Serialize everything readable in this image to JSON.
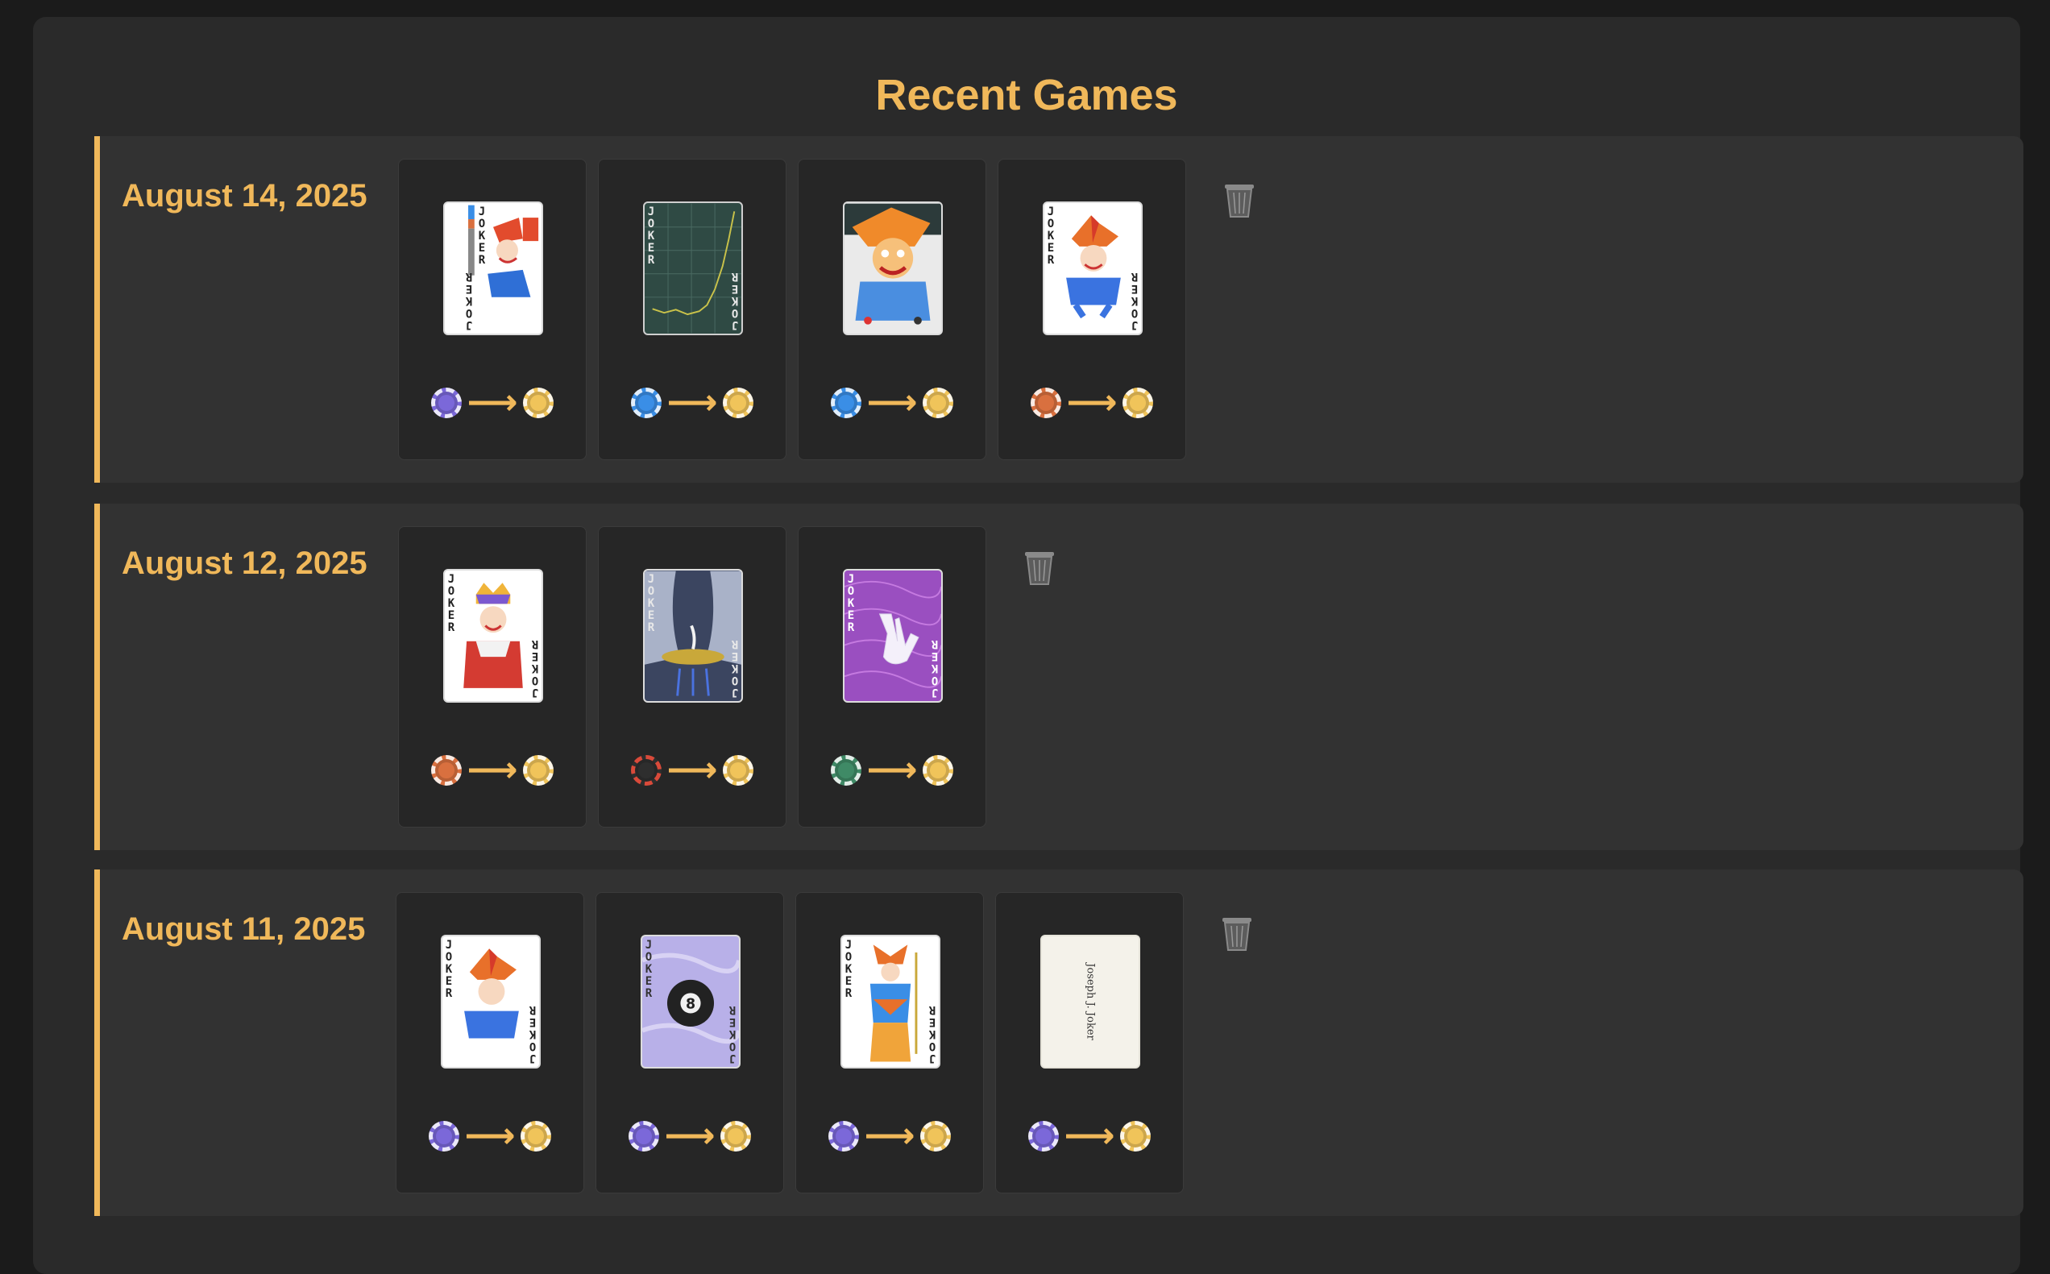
{
  "header": {
    "title": "Recent Games"
  },
  "colors": {
    "accent": "#f0b85a",
    "purple": "#7b68d9",
    "blue": "#3a8ee6",
    "orange": "#d9703f",
    "gold": "#f0c45a",
    "black": "#2e2e2e",
    "green": "#3f8a66"
  },
  "groups": [
    {
      "date": "August 14, 2025",
      "cards": [
        {
          "label": "JOKER",
          "theme": "color-bars-jester",
          "from_chip": "purple",
          "to_chip": "gold"
        },
        {
          "label": "JOKER",
          "theme": "green-graph",
          "from_chip": "blue",
          "to_chip": "gold"
        },
        {
          "label": "JOKER",
          "theme": "crazy-jester",
          "from_chip": "blue",
          "to_chip": "gold"
        },
        {
          "label": "JOKER",
          "theme": "classic-jester",
          "from_chip": "orange",
          "to_chip": "gold"
        }
      ],
      "delete_icon": "trash-icon"
    },
    {
      "date": "August 12, 2025",
      "cards": [
        {
          "label": "JOKER",
          "theme": "king-jester",
          "from_chip": "orange",
          "to_chip": "gold"
        },
        {
          "label": "JOKER",
          "theme": "stage-curtain",
          "from_chip": "black",
          "to_chip": "gold"
        },
        {
          "label": "JOKER",
          "theme": "purple-hand",
          "from_chip": "green",
          "to_chip": "gold"
        }
      ],
      "delete_icon": "trash-icon"
    },
    {
      "date": "August 11, 2025",
      "cards": [
        {
          "label": "JOKER",
          "theme": "classic-jester",
          "from_chip": "purple",
          "to_chip": "gold"
        },
        {
          "label": "JOKER",
          "theme": "eight-ball",
          "from_chip": "purple",
          "to_chip": "gold"
        },
        {
          "label": "JOKER",
          "theme": "face-card-jester",
          "from_chip": "purple",
          "to_chip": "gold"
        },
        {
          "label": "Joseph J. Joker",
          "theme": "business-card",
          "from_chip": "purple",
          "to_chip": "gold"
        }
      ],
      "delete_icon": "trash-icon"
    }
  ]
}
